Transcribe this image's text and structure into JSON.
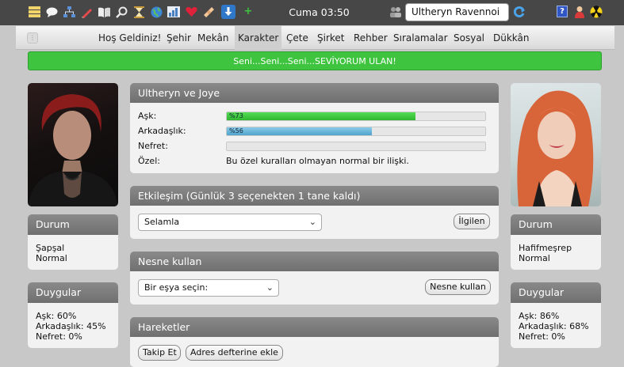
{
  "topbar": {
    "clock": "Cuma 03:50",
    "character_name": "Ultheryn Ravennoi"
  },
  "nav": {
    "items": [
      "Hoş Geldiniz!",
      "Şehir",
      "Mekân",
      "Karakter",
      "Çete",
      "Şirket",
      "Rehber",
      "Sıralamalar",
      "Sosyal",
      "Dükkân"
    ],
    "active": "Karakter"
  },
  "banner": {
    "text": "Seni...Seni...Seni...SEVİYORUM ULAN!"
  },
  "left": {
    "status_title": "Durum",
    "status_lines": [
      "Şapşal",
      "Normal"
    ],
    "feelings_title": "Duygular",
    "feelings_lines": [
      "Aşk: 60%",
      "Arkadaşlık: 45%",
      "Nefret: 0%"
    ]
  },
  "right": {
    "status_title": "Durum",
    "status_lines": [
      "Hafifmeşrep",
      "Normal"
    ],
    "feelings_title": "Duygular",
    "feelings_lines": [
      "Aşk: 86%",
      "Arkadaşlık: 68%",
      "Nefret: 0%"
    ]
  },
  "relationship": {
    "title": "Ultheryn ve Joye",
    "love_label": "Aşk:",
    "love_value": 73,
    "love_text": "%73",
    "friendship_label": "Arkadaşlık:",
    "friendship_value": 56,
    "friendship_text": "%56",
    "hate_label": "Nefret:",
    "hate_value": 0,
    "special_label": "Özel:",
    "special_text": "Bu özel kuralları olmayan normal bir ilişki."
  },
  "interaction": {
    "title": "Etkileşim (Günlük 3 seçenekten 1 tane kaldı)",
    "selected": "Selamla",
    "button": "İlgilen"
  },
  "item_use": {
    "title": "Nesne kullan",
    "placeholder": "Bir eşya seçin:",
    "button": "Nesne kullan"
  },
  "actions": {
    "title": "Hareketler",
    "follow_button": "Takip Et",
    "address_button": "Adres defterine ekle"
  },
  "colors": {
    "love_bar": "#33c433",
    "friendship_bar": "#5aaed6",
    "banner": "#3ec43e",
    "panel_header": "#7d7d7d",
    "topbar": "#474747"
  }
}
